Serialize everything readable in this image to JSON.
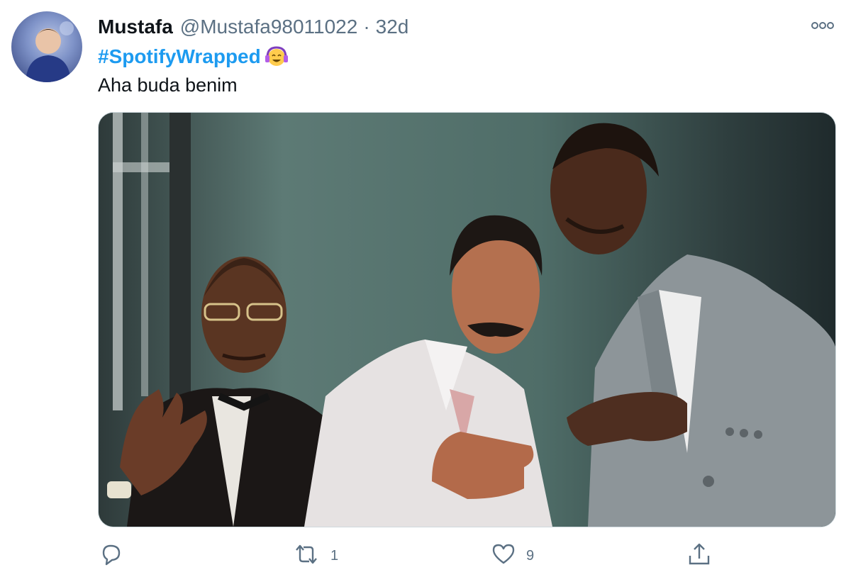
{
  "tweet": {
    "display_name": "Mustafa",
    "handle": "@Mustafa98011022",
    "separator": "·",
    "time": "32d",
    "hashtag": "#SpotifyWrapped",
    "emoji_icon": "headphones-face-emoji-icon",
    "text": "Aha buda benim"
  },
  "media": {
    "icon": "photo",
    "background": "#4f6a66"
  },
  "actions": {
    "reply_icon": "reply-icon",
    "reply_count": "",
    "retweet_icon": "retweet-icon",
    "retweet_count": "1",
    "like_icon": "heart-icon",
    "like_count": "9",
    "share_icon": "share-icon"
  },
  "colors": {
    "hashtag": "#1d9bf0",
    "secondary_text": "#5b7083",
    "primary_text": "#0f1419",
    "border": "#cfd9de"
  }
}
